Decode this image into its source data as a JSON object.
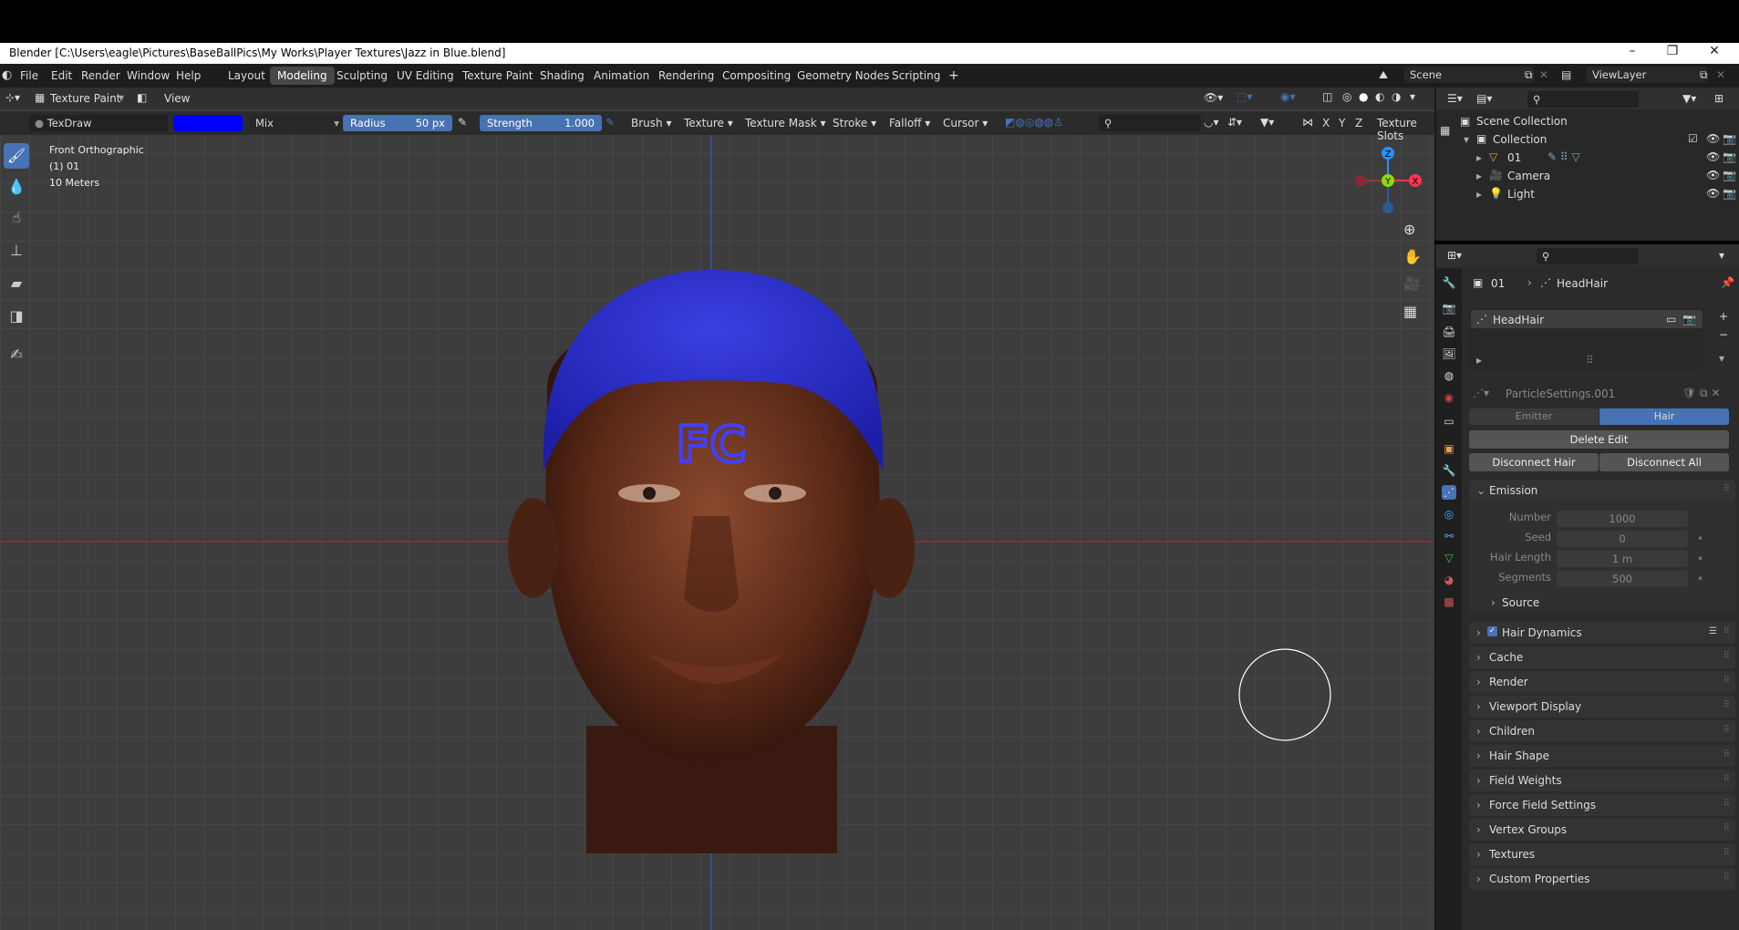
{
  "window": {
    "title": "Blender [C:\\Users\\eagle\\Pictures\\BaseBallPics\\My Works\\Player Textures\\Jazz in Blue.blend]"
  },
  "menus": [
    "File",
    "Edit",
    "Render",
    "Window",
    "Help"
  ],
  "workspaces": [
    "Layout",
    "Modeling",
    "Sculpting",
    "UV Editing",
    "Texture Paint",
    "Shading",
    "Animation",
    "Rendering",
    "Compositing",
    "Geometry Nodes",
    "Scripting"
  ],
  "active_workspace": "Modeling",
  "scene": {
    "name": "Scene",
    "view_layer": "ViewLayer"
  },
  "header": {
    "mode": "Texture Paint",
    "view": "View"
  },
  "tool_settings": {
    "brush": "TexDraw",
    "color": "#0000ff",
    "blend": "Mix",
    "radius_label": "Radius",
    "radius_value": "50 px",
    "strength_label": "Strength",
    "strength_value": "1.000",
    "menus": [
      "Brush",
      "Texture",
      "Texture Mask",
      "Stroke",
      "Falloff",
      "Cursor"
    ],
    "axes": [
      "X",
      "Y",
      "Z"
    ],
    "texture_slots": "Texture Slots"
  },
  "viewport": {
    "view_name": "Front Orthographic",
    "object": "(1) 01",
    "scale": "10 Meters",
    "forehead_text": "FC"
  },
  "gizmo": {
    "z": "Z",
    "y": "Y",
    "x": "X"
  },
  "outliner": {
    "root": "Scene Collection",
    "collection": "Collection",
    "items": [
      "01",
      "Camera",
      "Light"
    ]
  },
  "properties": {
    "breadcrumb_object": "01",
    "breadcrumb_system": "HeadHair",
    "system_name": "HeadHair",
    "settings_name": "ParticleSettings.001",
    "type_emitter": "Emitter",
    "type_hair": "Hair",
    "delete_edit": "Delete Edit",
    "disconnect_hair": "Disconnect Hair",
    "disconnect_all": "Disconnect All",
    "emission": {
      "title": "Emission",
      "fields": [
        {
          "label": "Number",
          "value": "1000"
        },
        {
          "label": "Seed",
          "value": "0"
        },
        {
          "label": "Hair Length",
          "value": "1 m"
        },
        {
          "label": "Segments",
          "value": "500"
        }
      ],
      "source": "Source"
    },
    "panels": [
      "Hair Dynamics",
      "Cache",
      "Render",
      "Viewport Display",
      "Children",
      "Hair Shape",
      "Field Weights",
      "Force Field Settings",
      "Vertex Groups",
      "Textures",
      "Custom Properties"
    ]
  },
  "colors": {
    "accent": "#4772b3",
    "brush": "#0000ff",
    "x_axis": "#ff3352",
    "y_axis": "#8bdc00",
    "z_axis": "#2890ff"
  }
}
